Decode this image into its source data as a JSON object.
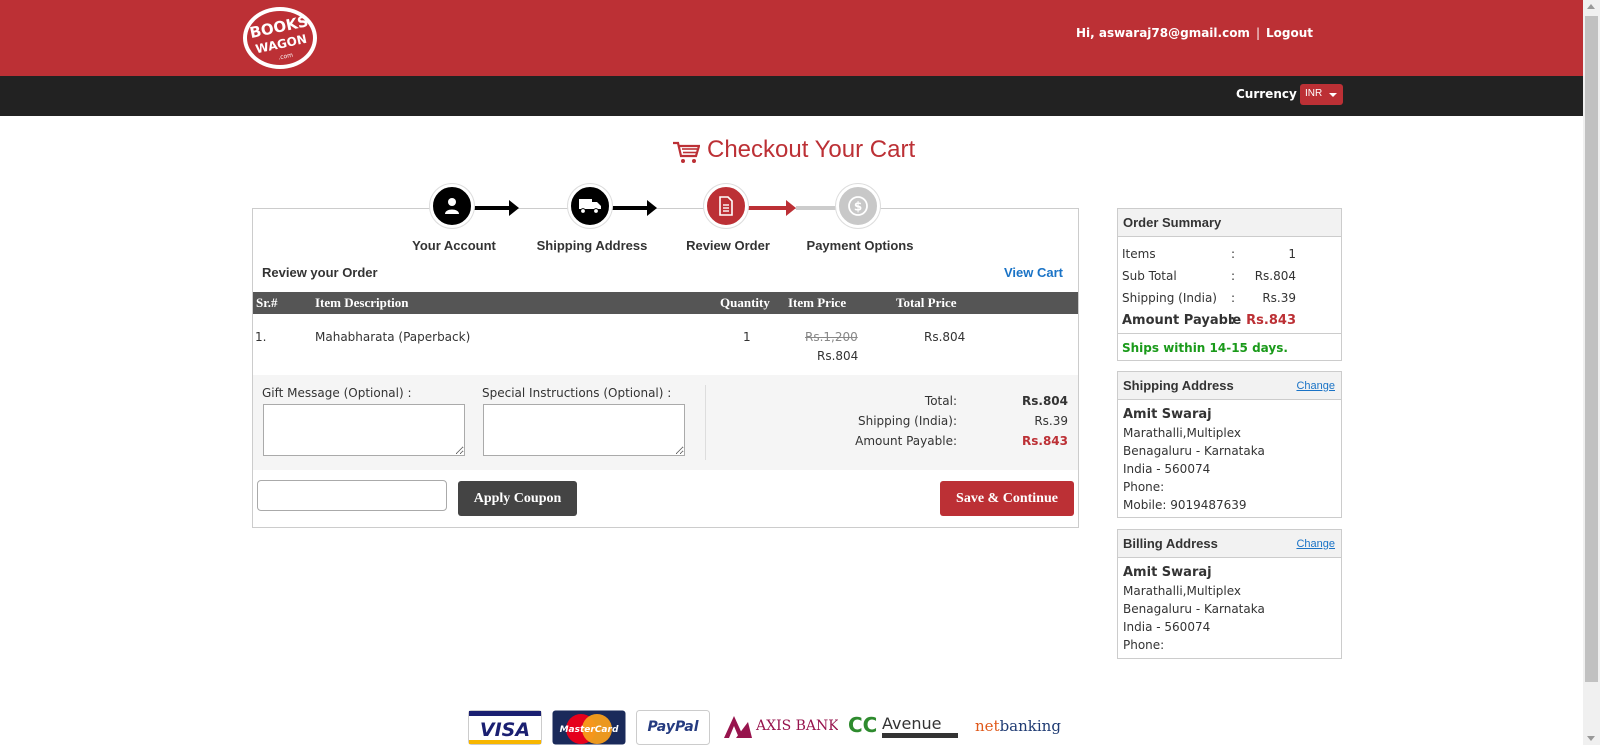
{
  "header": {
    "logo_text_top": "BOOKS",
    "logo_text_bottom": "WAGON",
    "logo_text_domain": ".com",
    "greeting": "Hi, aswaraj78@gmail.com",
    "separator": "|",
    "logout": "Logout",
    "currency_label": "Currency",
    "currency_value": "INR"
  },
  "page": {
    "title": "Checkout Your Cart"
  },
  "steps": [
    {
      "label": "Your Account",
      "icon": "user-icon",
      "state": "done"
    },
    {
      "label": "Shipping Address",
      "icon": "truck-icon",
      "state": "done"
    },
    {
      "label": "Review Order",
      "icon": "document-icon",
      "state": "active"
    },
    {
      "label": "Payment Options",
      "icon": "dollar-icon",
      "state": "pending"
    }
  ],
  "review": {
    "heading": "Review your Order",
    "view_cart": "View Cart",
    "columns": [
      "Sr.#",
      "Item Description",
      "Quantity",
      "Item Price",
      "Total Price"
    ],
    "rows": [
      {
        "sr": "1.",
        "description": "Mahabharata (Paperback)",
        "quantity": "1",
        "mrp": "Rs.1,200",
        "price": "Rs.804",
        "total": "Rs.804"
      }
    ],
    "gift_label": "Gift Message (Optional) :",
    "instructions_label": "Special Instructions (Optional) :",
    "totals": [
      {
        "label": "Total:",
        "value": "Rs.804"
      },
      {
        "label": "Shipping (India):",
        "value": "Rs.39"
      },
      {
        "label": "Amount Payable:",
        "value": "Rs.843"
      }
    ],
    "coupon_value": "",
    "apply_coupon": "Apply Coupon",
    "save_continue": "Save & Continue"
  },
  "summary": {
    "heading": "Order Summary",
    "rows": [
      {
        "label": "Items",
        "sep": ":",
        "value": "1"
      },
      {
        "label": "Sub Total",
        "sep": ":",
        "value": "Rs.804"
      },
      {
        "label": "Shipping (India)",
        "sep": ":",
        "value": "Rs.39"
      },
      {
        "label": "Amount Payable",
        "sep": ":",
        "value": "Rs.843"
      }
    ],
    "ships_note": "Ships within 14-15 days."
  },
  "shipping_address": {
    "heading": "Shipping Address",
    "change": "Change",
    "name": "Amit Swaraj",
    "lines": [
      "Marathalli,Multiplex",
      "Benagaluru - Karnataka",
      "India - 560074",
      "Phone:",
      "Mobile: 9019487639"
    ]
  },
  "billing_address": {
    "heading": "Billing Address",
    "change": "Change",
    "name": "Amit Swaraj",
    "lines": [
      "Marathalli,Multiplex",
      "Benagaluru - Karnataka",
      "India - 560074",
      "Phone:"
    ]
  },
  "payment_logos": {
    "visa": "VISA",
    "mastercard": "MasterCard",
    "paypal": "PayPal",
    "axis": "AXIS BANK",
    "ccavenue": "Avenue",
    "ccavenue_prefix": "CC",
    "netbanking_a": "net",
    "netbanking_b": "banking"
  },
  "colors": {
    "brand_red": "#bc3035",
    "link_blue": "#1a73c6",
    "green": "#1a9a1a"
  }
}
